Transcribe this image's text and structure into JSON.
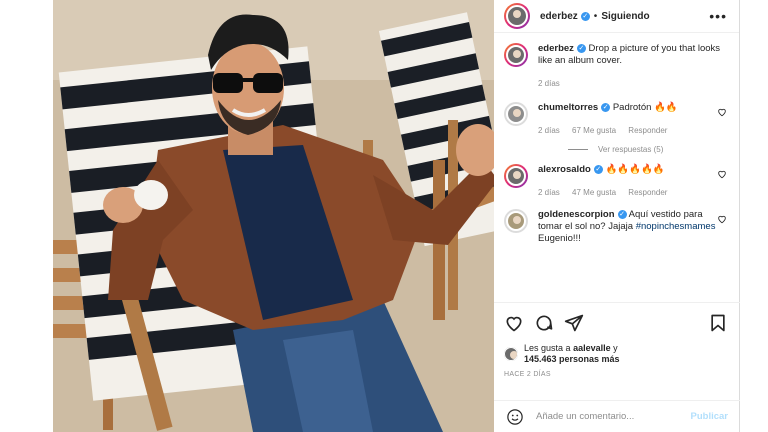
{
  "post": {
    "username": "ederbez",
    "follow_status": "Siguiendo",
    "more_label": "•••",
    "caption": "Drop a picture of you that looks like an album cover.",
    "caption_time": "2 días"
  },
  "comments": [
    {
      "user": "chumeltorres",
      "text": "Padrotón 🔥🔥",
      "time": "2 días",
      "likes": "67 Me gusta",
      "reply": "Responder",
      "verified": true
    },
    {
      "user": "alexrosaldo",
      "text": "🔥🔥🔥🔥🔥",
      "time": "2 días",
      "likes": "47 Me gusta",
      "reply": "Responder",
      "verified": true
    },
    {
      "user": "goldenescorpion",
      "text": "Aquí vestido para tomar el sol no? Jajaja",
      "hashtag": "#nopinchesmames",
      "text_after": "Eugenio!!!",
      "verified": true
    }
  ],
  "view_replies": "Ver respuestas (5)",
  "likes_line": {
    "prefix": "Les gusta a",
    "user": "aalevalle",
    "connector": "y",
    "count": "145.463 personas más"
  },
  "posted_ago": "HACE 2 DÍAS",
  "add_comment_placeholder": "Añade un comentario...",
  "publish_label": "Publicar",
  "icons": [
    "heart-icon",
    "comment-icon",
    "share-icon",
    "bookmark-icon",
    "emoji-icon",
    "more-icon"
  ],
  "colors": {
    "verified": "#3897f0",
    "publish": "#b2dffc",
    "hashtag": "#00376b",
    "fire": "#f56a00"
  }
}
